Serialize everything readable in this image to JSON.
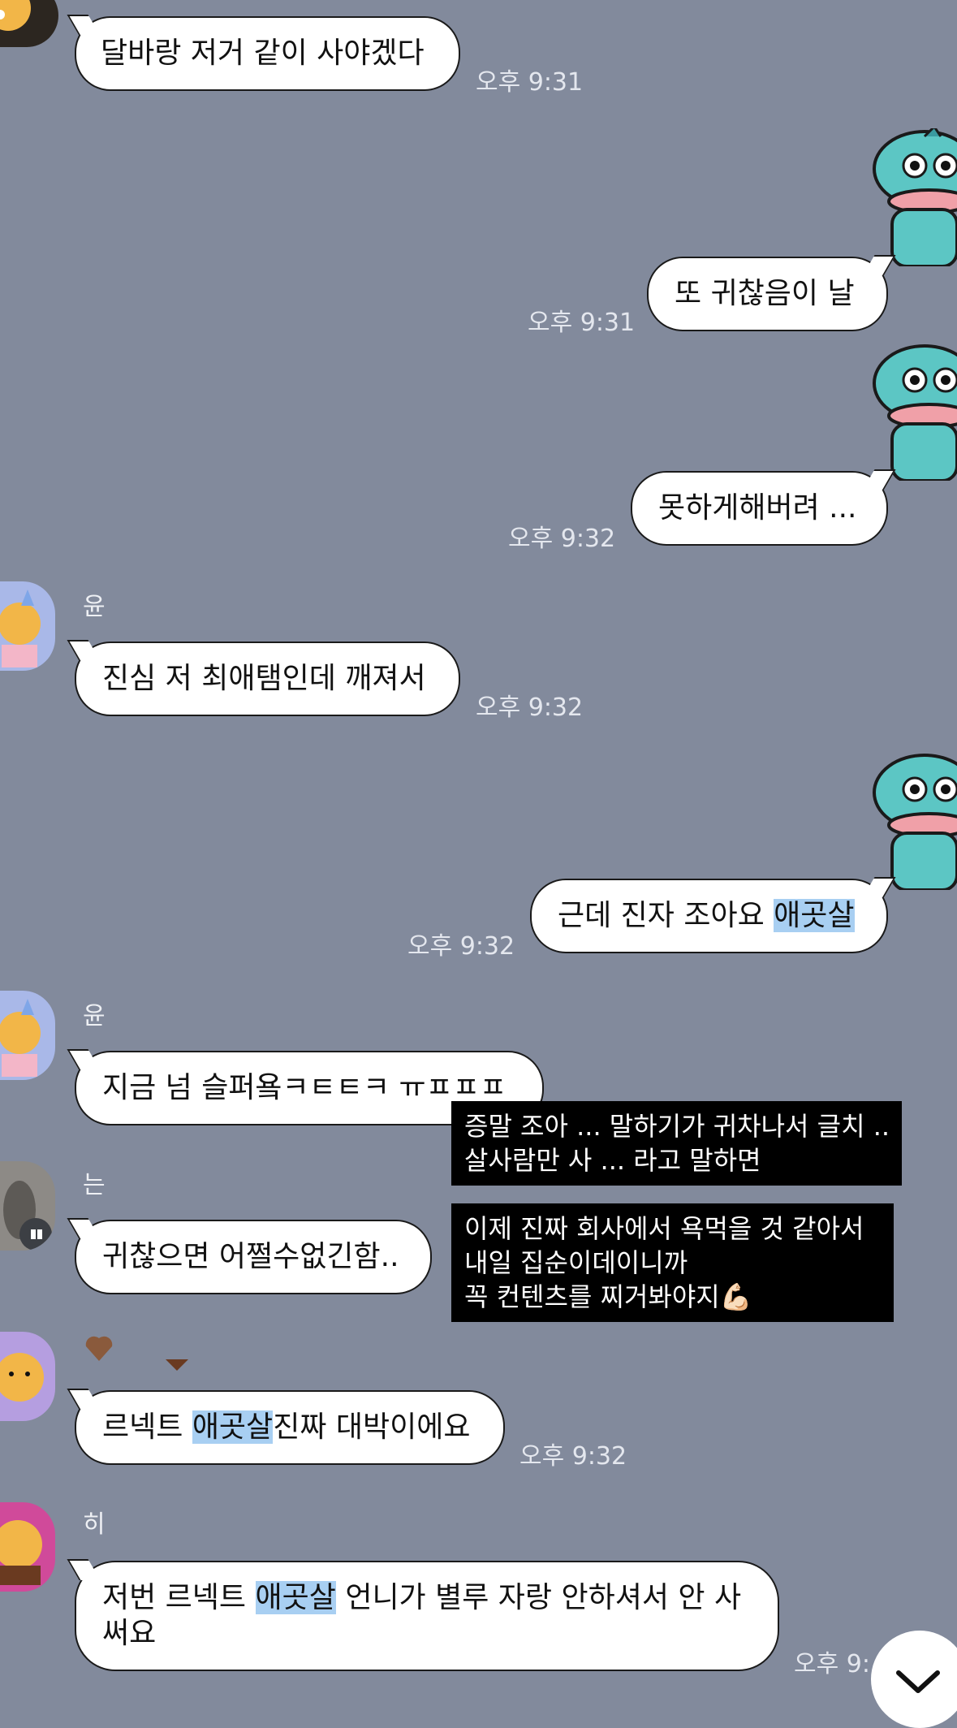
{
  "messages": [
    {
      "text": "달바랑 저거 같이 사야겠다",
      "time": "오후 9:31"
    },
    {
      "text": "또 귀찮음이 날",
      "time": "오후 9:31"
    },
    {
      "text": "못하게해버려 ...",
      "time": "오후 9:32"
    },
    {
      "sender": "윤",
      "text": "진심 저 최애탬인데 깨져서",
      "time": "오후 9:32"
    },
    {
      "text_before": "근데 진자 조아요 ",
      "highlight": "애곳살",
      "time": "오후 9:32"
    },
    {
      "sender": "윤",
      "text": "지금 넘 슬퍼욬ㅋㅌㅌㅋ ㅠㅍㅍㅍ"
    },
    {
      "sender": "는",
      "text": "귀찮으면 어쩔수없긴함.."
    },
    {
      "text_before": "르넥트 ",
      "highlight": "애곳살",
      "text_after": "진짜 대박이에요",
      "time": "오후 9:32"
    },
    {
      "sender": "히",
      "line1_before": "저번 르넥트 ",
      "highlight": "애곳살",
      "line1_after": " 언니가 별루 자랑 안하셔서 안 사",
      "line2": "써요",
      "time": "오후 9:"
    }
  ],
  "overlay": {
    "box1": [
      "증말 조아 ... 말하기가 귀차나서 글치 ..",
      "살사람만 사 ... 라고 말하면"
    ],
    "box2": [
      "이제 진짜 회사에서 욕먹을 것 같아서",
      "내일 집순이데이니까",
      "꼭 컨텐츠를 찌거봐야지"
    ],
    "emoji": "💪🏻"
  },
  "colors": {
    "background": "#828a9c",
    "highlight": "#a8cff2",
    "bubble": "#ffffff"
  },
  "icons": [
    "chevron-down-icon",
    "hangyodon-sticker",
    "ryan-avatar",
    "heart-icon"
  ]
}
